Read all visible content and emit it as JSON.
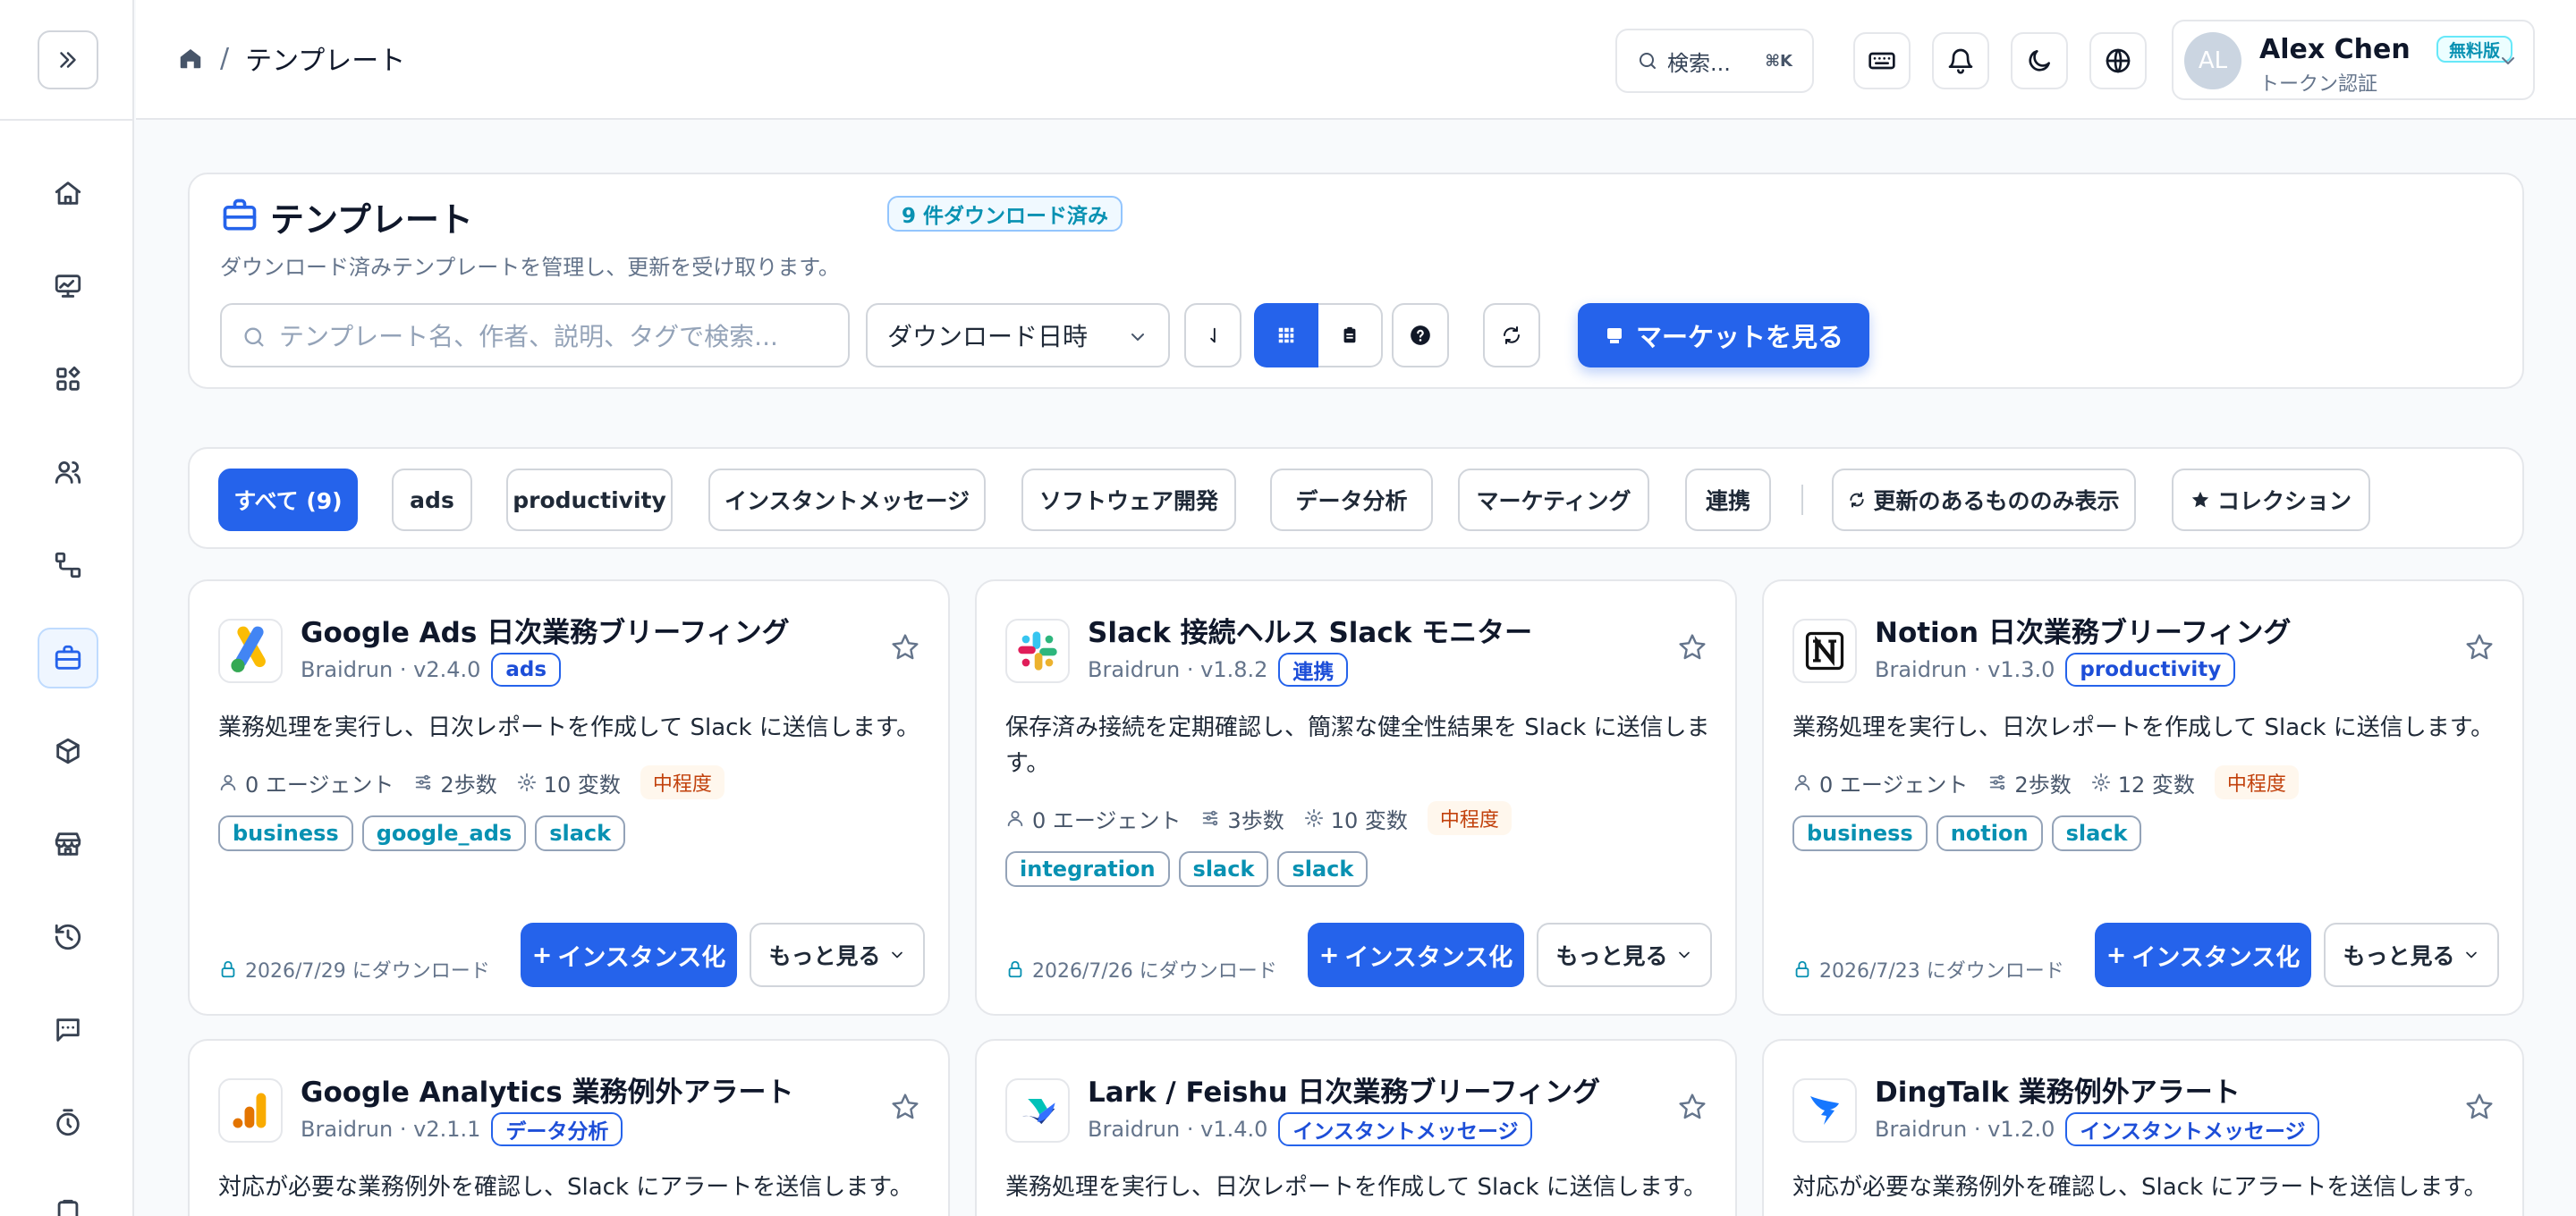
{
  "breadcrumb": {
    "current": "テンプレート"
  },
  "topbar": {
    "search_label": "検索...",
    "search_kbd": "⌘K",
    "user": {
      "initials": "AL",
      "name": "Alex Chen",
      "plan": "無料版",
      "auth": "トークン認証"
    }
  },
  "header": {
    "title": "テンプレート",
    "downloaded_badge": "9 件ダウンロード済み",
    "subtitle": "ダウンロード済みテンプレートを管理し、更新を受け取ります。",
    "search_placeholder": "テンプレート名、作者、説明、タグで検索...",
    "sort_value": "ダウンロード日時",
    "market_button": "マーケットを見る"
  },
  "filters": {
    "chips": [
      {
        "label": "すべて (9)",
        "active": true
      },
      {
        "label": "ads"
      },
      {
        "label": "productivity"
      },
      {
        "label": "インスタントメッセージ"
      },
      {
        "label": "ソフトウェア開発"
      },
      {
        "label": "データ分析"
      },
      {
        "label": "マーケティング"
      },
      {
        "label": "連携"
      }
    ],
    "updates_only": "更新のあるもののみ表示",
    "collection": "コレクション"
  },
  "card_labels": {
    "instantiate": "インスタンス化",
    "more": "もっと見る"
  },
  "cards": [
    {
      "title": "Google Ads 日次業務ブリーフィング",
      "meta": "Braidrun · v2.4.0",
      "category": "ads",
      "description": "業務処理を実行し、日次レポートを作成して Slack に送信します。",
      "agents": "0 エージェント",
      "steps": "2歩数",
      "vars": "10 変数",
      "level": "中程度",
      "tags": [
        "business",
        "google_ads",
        "slack"
      ],
      "date": "2026/7/29 にダウンロード"
    },
    {
      "title": "Slack 接続ヘルス Slack モニター",
      "meta": "Braidrun · v1.8.2",
      "category": "連携",
      "description": "保存済み接続を定期確認し、簡潔な健全性結果を Slack に送信します。",
      "agents": "0 エージェント",
      "steps": "3歩数",
      "vars": "10 変数",
      "level": "中程度",
      "tags": [
        "integration",
        "slack",
        "slack"
      ],
      "date": "2026/7/26 にダウンロード"
    },
    {
      "title": "Notion 日次業務ブリーフィング",
      "meta": "Braidrun · v1.3.0",
      "category": "productivity",
      "description": "業務処理を実行し、日次レポートを作成して Slack に送信します。",
      "agents": "0 エージェント",
      "steps": "2歩数",
      "vars": "12 変数",
      "level": "中程度",
      "tags": [
        "business",
        "notion",
        "slack"
      ],
      "date": "2026/7/23 にダウンロード"
    },
    {
      "title": "Google Analytics 業務例外アラート",
      "meta": "Braidrun · v2.1.1",
      "category": "データ分析",
      "description": "対応が必要な業務例外を確認し、Slack にアラートを送信します。"
    },
    {
      "title": "Lark / Feishu 日次業務ブリーフィング",
      "meta": "Braidrun · v1.4.0",
      "category": "インスタントメッセージ",
      "description": "業務処理を実行し、日次レポートを作成して Slack に送信します。"
    },
    {
      "title": "DingTalk 業務例外アラート",
      "meta": "Braidrun · v1.2.0",
      "category": "インスタントメッセージ",
      "description": "対応が必要な業務例外を確認し、Slack にアラートを送信します。"
    }
  ],
  "colors": {
    "primary": "#2563eb",
    "tag_text": "#0891b2",
    "level_bg": "#fff7ed",
    "level_text": "#c2410c"
  }
}
